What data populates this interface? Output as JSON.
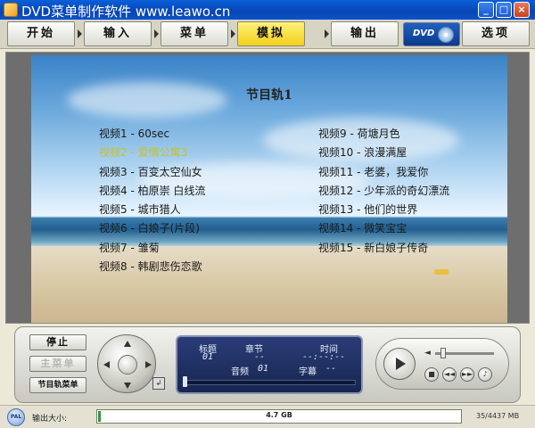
{
  "window": {
    "title": "DVD菜单制作软件 www.leawo.cn",
    "minimize": "_",
    "maximize": "□",
    "close": "×"
  },
  "tabs": [
    {
      "label": "开始"
    },
    {
      "label": "输入"
    },
    {
      "label": "菜单"
    },
    {
      "label": "模拟",
      "active": true
    },
    {
      "label": "输出"
    },
    {
      "label": "选项"
    }
  ],
  "logo": {
    "text": "DVD"
  },
  "menu_preview": {
    "title": "节目轨1",
    "left_items": [
      "视频1 - 60sec",
      "视频2 - 爱情公寓3",
      "视频3 - 百变太空仙女",
      "视频4 - 柏原崇 白线流",
      "视频5 - 城市猎人",
      "视频6 - 白娘子(片段)",
      "视频7 - 雏菊",
      "视频8 - 韩剧悲伤恋歌"
    ],
    "right_items": [
      "视频9 - 荷塘月色",
      "视频10 - 浪漫满屋",
      "视频11 - 老婆，我爱你",
      "视频12 - 少年派的奇幻漂流",
      "视频13 - 他们的世界",
      "视频14 - 微笑宝宝",
      "视频15 - 新白娘子传奇"
    ],
    "highlighted_index": 1,
    "highlight_color": "#c7c22c"
  },
  "controls": {
    "stop": "停止",
    "main_menu": "主菜单",
    "title_menu": "节目轨菜单",
    "lcd": {
      "title_label": "标题",
      "title_value": "01",
      "chapter_label": "章节",
      "chapter_value": "--",
      "time_label": "时间",
      "time_value": "--:--:--",
      "audio_label": "音频",
      "audio_value": "01",
      "subtitle_label": "字幕",
      "subtitle_value": "--"
    }
  },
  "status": {
    "format": "PAL",
    "output_label": "输出大小:",
    "capacity": "4.7 GB",
    "usage": "35/4437 MB",
    "usage_fraction": 0.008
  }
}
